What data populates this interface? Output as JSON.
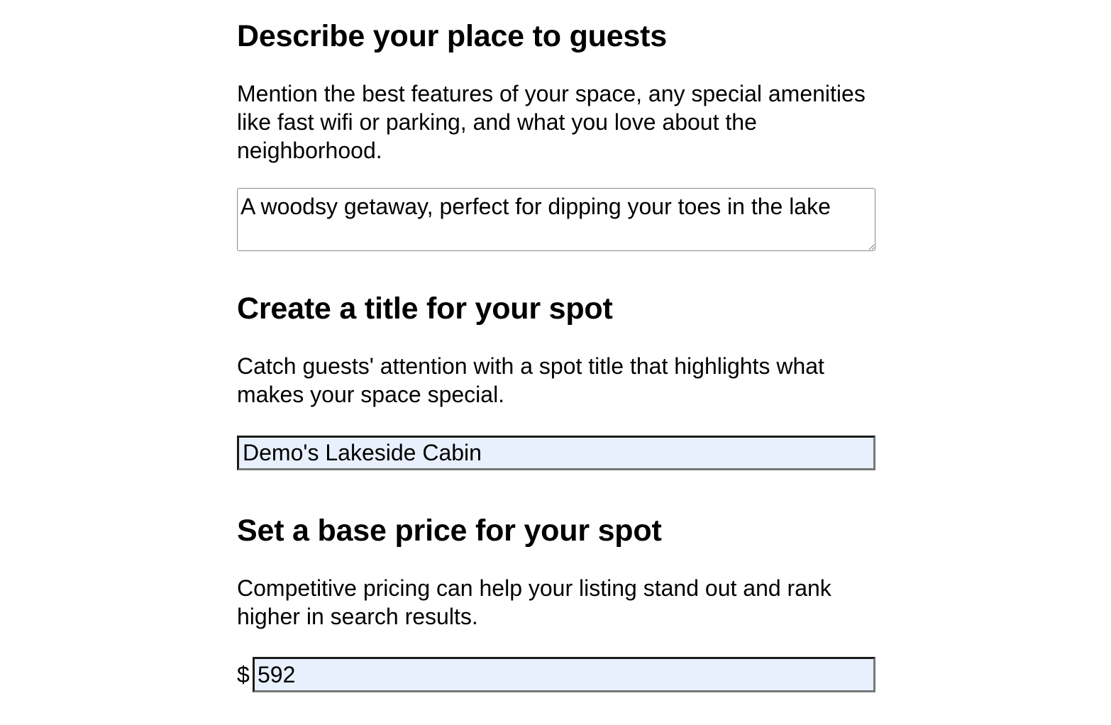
{
  "describe_section": {
    "heading": "Describe your place to guests",
    "description": "Mention the best features of your space, any special amenities like fast wifi or parking, and what you love about the neighborhood.",
    "textarea_value": "A woodsy getaway, perfect for dipping your toes in the lake"
  },
  "title_section": {
    "heading": "Create a title for your spot",
    "description": "Catch guests' attention with a spot title that highlights what makes your space special.",
    "input_value": "Demo's Lakeside Cabin"
  },
  "price_section": {
    "heading": "Set a base price for your spot",
    "description": "Competitive pricing can help your listing stand out and rank higher in search results.",
    "currency_symbol": "$",
    "input_value": "592"
  },
  "colors": {
    "autofill_background": "#e8f0fe",
    "text": "#000000"
  }
}
